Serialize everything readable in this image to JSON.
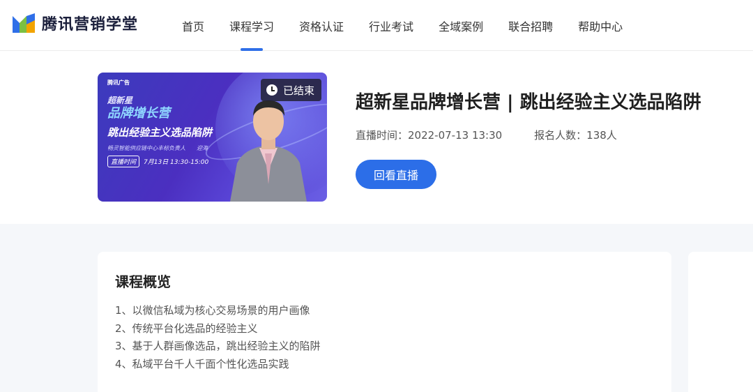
{
  "brand": {
    "name": "腾讯营销学堂",
    "colors": [
      "#2f6fe8",
      "#7bc043",
      "#f2a400"
    ]
  },
  "nav": {
    "items": [
      {
        "label": "首页"
      },
      {
        "label": "课程学习",
        "active": true
      },
      {
        "label": "资格认证"
      },
      {
        "label": "行业考试"
      },
      {
        "label": "全域案例"
      },
      {
        "label": "联合招聘"
      },
      {
        "label": "帮助中心"
      }
    ],
    "accent": "#2f6fe8"
  },
  "course": {
    "cover": {
      "brand": "腾讯广告",
      "line1": "超新星",
      "line2": "品牌增长营",
      "line3": "跳出经验主义选品陷阱",
      "line4": "畅灵智能供应链中心丰标负责人　　迎海",
      "time_tag": "直播时间",
      "time_value": "7月13日 13:30-15:00"
    },
    "status": "已结束",
    "status_icon": "clock-icon",
    "title": "超新星品牌增长营 | 跳出经验主义选品陷阱",
    "live_time": "直播时间：2022-07-13 13:30",
    "signup_count": "报名人数：138人",
    "replay_button": "回看直播"
  },
  "overview": {
    "heading": "课程概览",
    "items": [
      "1、以微信私域为核心交易场景的用户画像",
      "2、传统平台化选品的经验主义",
      "3、基于人群画像选品，跳出经验主义的陷阱",
      "4、私域平台千人千面个性化选品实践"
    ]
  }
}
